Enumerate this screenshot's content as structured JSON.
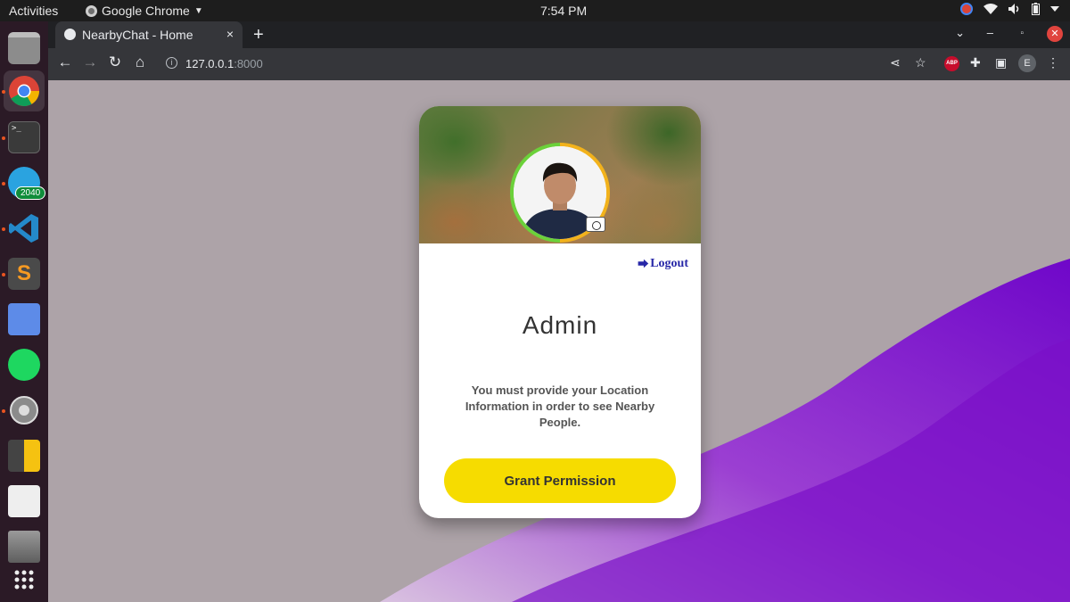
{
  "topbar": {
    "activities": "Activities",
    "app_name": "Google Chrome",
    "app_menu_icon": "caret-down-icon",
    "clock": "7:54 PM"
  },
  "dock": {
    "items": [
      "files",
      "google-chrome",
      "terminal",
      "telegram",
      "vscode",
      "sublime-text",
      "tasks",
      "spotify",
      "settings",
      "calculator",
      "tweaks",
      "drive",
      "show-apps"
    ],
    "telegram_badge": "2040"
  },
  "browser": {
    "tab_title": "NearbyChat - Home",
    "close_icon": "×",
    "new_tab_icon": "+",
    "url_host": "127.0.0.1",
    "url_port": ":8000",
    "profile_initial": "E",
    "extension_abp": "ABP"
  },
  "page": {
    "background_color": "#ada3a8",
    "accent_purple": "#7a10c8",
    "card": {
      "logout_icon": "sign-out-icon",
      "logout_label": "Logout",
      "name": "Admin",
      "message": "You must provide your Location Information in order to see Nearby People.",
      "grant_label": "Grant Permission",
      "grant_color": "#f6dc00"
    }
  }
}
